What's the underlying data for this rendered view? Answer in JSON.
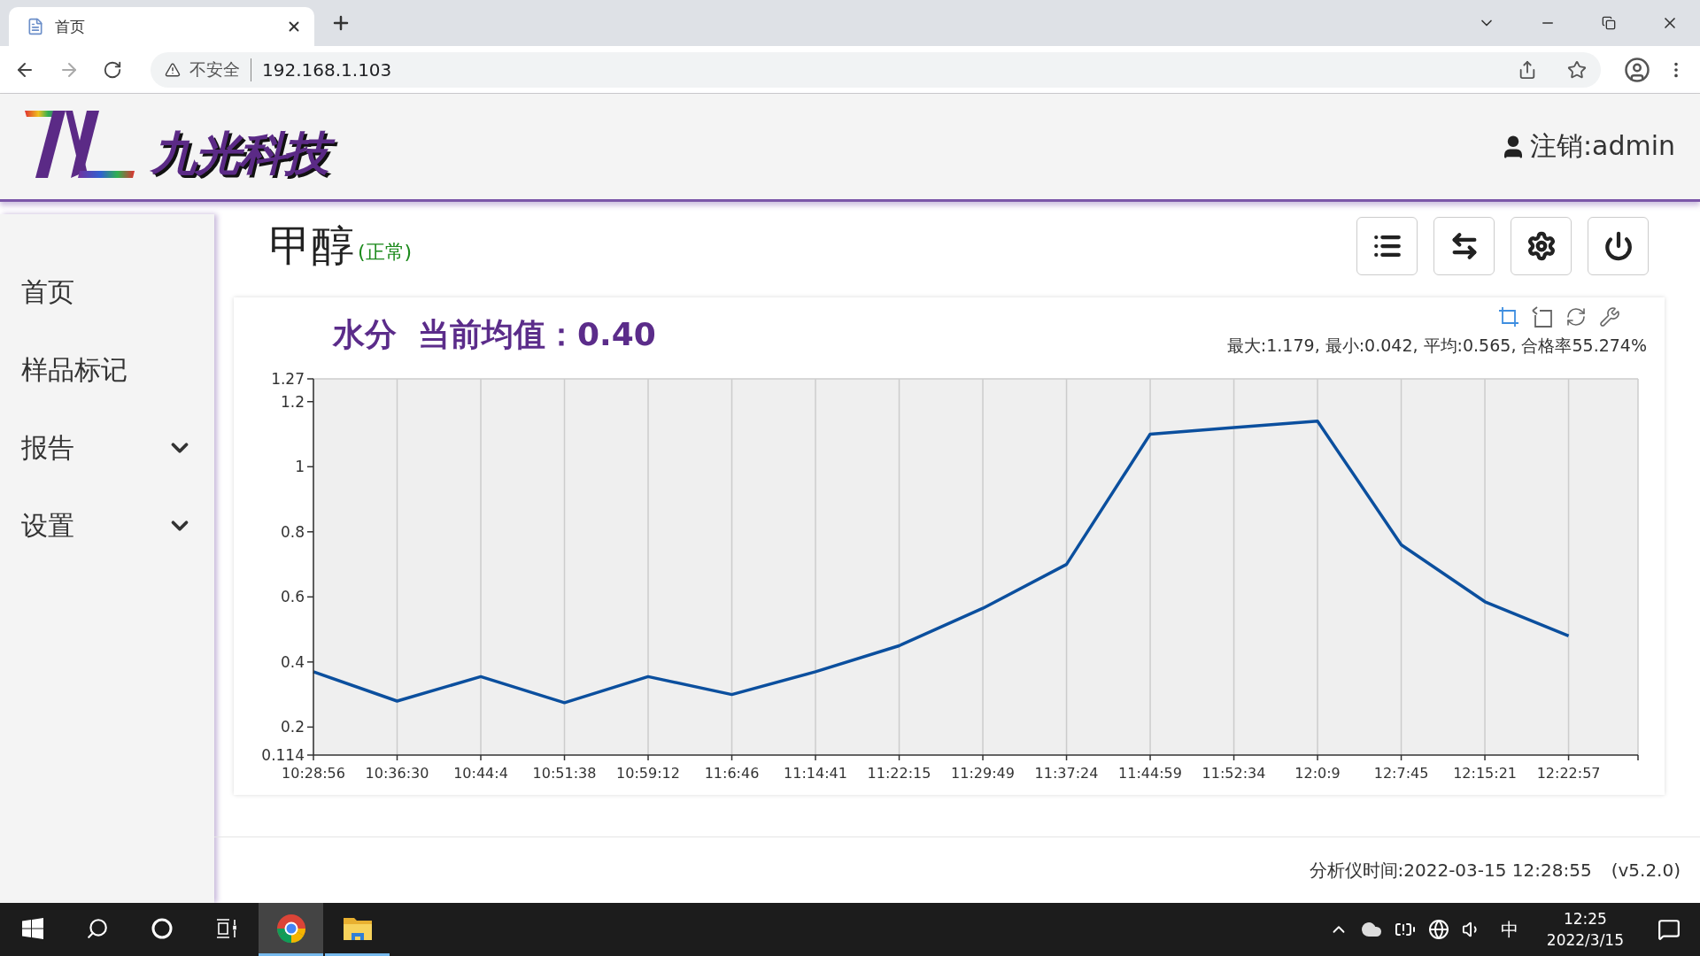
{
  "browser": {
    "tab": {
      "title": "首页"
    },
    "security": "不安全",
    "url": "192.168.1.103"
  },
  "header": {
    "brand": "九光科技",
    "user": "注销:admin"
  },
  "sidebar": {
    "items": [
      {
        "label": "首页",
        "kind": "link"
      },
      {
        "label": "样品标记",
        "kind": "link"
      },
      {
        "label": "报告",
        "kind": "group",
        "expanded": false
      },
      {
        "label": "设置",
        "kind": "group",
        "expanded": false
      }
    ]
  },
  "page": {
    "title": "甲醇",
    "status": "(正常)",
    "actions": [
      {
        "kind": "list"
      },
      {
        "kind": "swap"
      },
      {
        "kind": "settings"
      },
      {
        "kind": "power"
      }
    ]
  },
  "chart_card": {
    "current": "当前均值：0.40",
    "tools": [
      {
        "kind": "zoom",
        "selected": true
      },
      {
        "kind": "zoom-reset",
        "selected": false
      },
      {
        "kind": "restore",
        "selected": false
      },
      {
        "kind": "config",
        "selected": false
      }
    ],
    "stats": "最大:1.179, 最小:0.042, 平均:0.565, 合格率55.274%",
    "chart_data": {
      "type": "line",
      "grid": true,
      "ylim": [
        0.114,
        1.27
      ],
      "yticks": [
        0.114,
        0.2,
        0.4,
        0.6,
        0.8,
        1,
        1.2,
        1.27
      ],
      "categories": [
        "10:28:56",
        "10:36:30",
        "10:44:4",
        "10:51:38",
        "10:59:12",
        "11:6:46",
        "11:14:41",
        "11:22:15",
        "11:29:49",
        "11:37:24",
        "11:44:59",
        "11:52:34",
        "12:0:9",
        "12:7:45",
        "12:15:21",
        "12:22:57"
      ],
      "series": [
        {
          "name": "水分",
          "color": "#0b4f9e",
          "values": [
            0.37,
            0.28,
            0.355,
            0.275,
            0.355,
            0.3,
            0.37,
            0.45,
            0.565,
            0.7,
            1.1,
            1.12,
            1.14,
            0.76,
            0.585,
            0.48
          ]
        }
      ]
    }
  },
  "footer": {
    "time": "分析仪时间:2022-03-15 12:28:55",
    "version": "(v5.2.0)"
  },
  "taskbar": {
    "apps": [
      {
        "kind": "chrome",
        "selected": true
      },
      {
        "kind": "explorer",
        "selected": false
      }
    ],
    "ime": "中",
    "time": "12:25",
    "date": "2022/3/15"
  }
}
